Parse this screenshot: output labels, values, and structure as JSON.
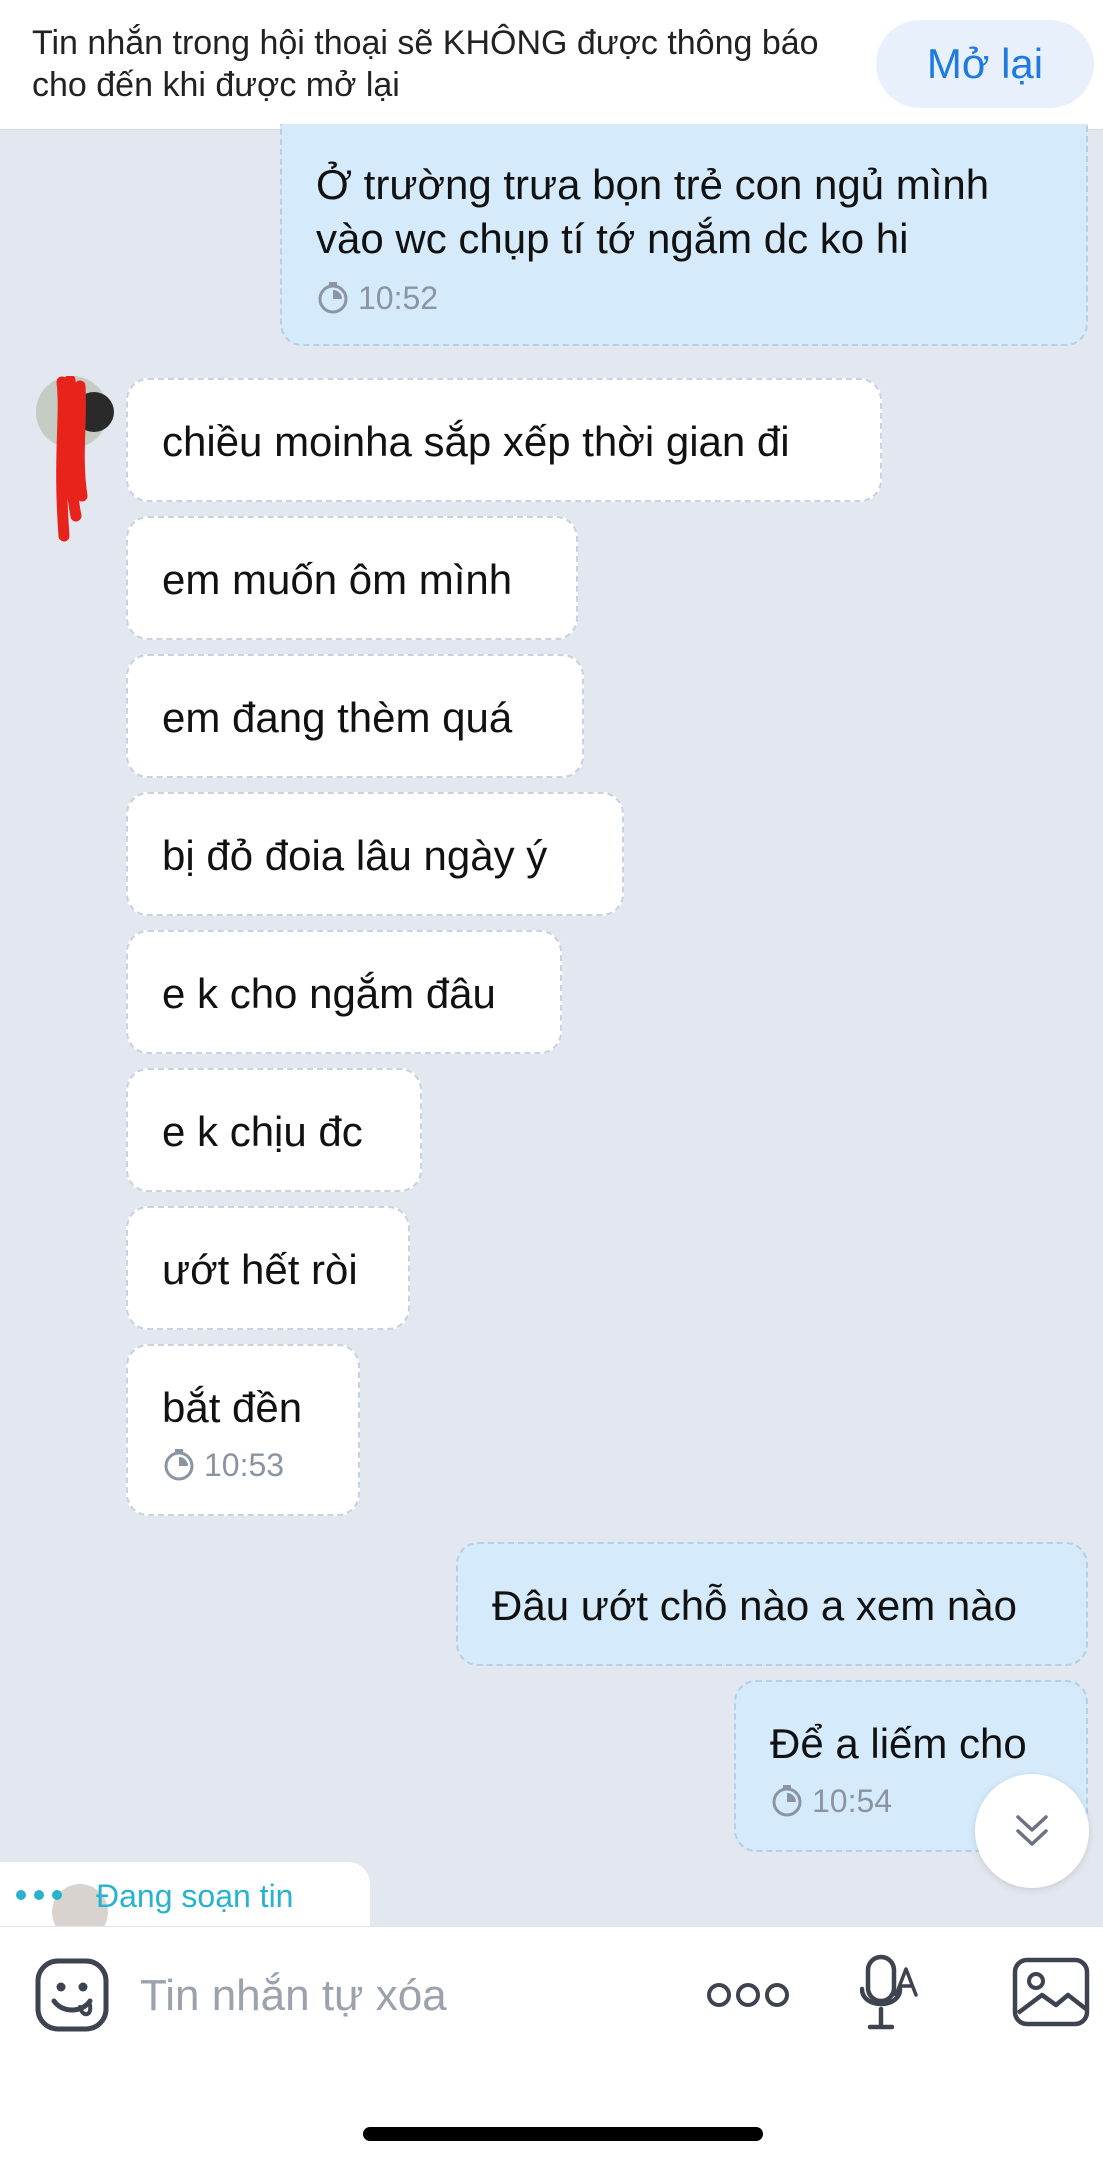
{
  "notice": {
    "text": "Tin nhắn trong hội thoại sẽ KHÔNG được thông báo cho đến khi được mở lại",
    "reopen_label": "Mở lại"
  },
  "messages": [
    {
      "direction": "out",
      "text_lines": [
        "Ở trường trưa bọn trẻ con ngủ mình",
        "vào wc chụp tí tớ ngắm dc ko hi"
      ],
      "time": "10:52"
    },
    {
      "direction": "in",
      "text": "chiều moinha sắp xếp thời gian đi"
    },
    {
      "direction": "in",
      "text": "em muốn ôm mình"
    },
    {
      "direction": "in",
      "text": "em đang thèm quá"
    },
    {
      "direction": "in",
      "text": "bị đỏ đoia lâu ngày ý"
    },
    {
      "direction": "in",
      "text": "e k cho ngắm đâu"
    },
    {
      "direction": "in",
      "text": "e k chịu đc"
    },
    {
      "direction": "in",
      "text": "ướt hết ròi"
    },
    {
      "direction": "in",
      "text": "bắt đền",
      "time": "10:53"
    },
    {
      "direction": "out",
      "text": "Đâu ướt chỗ nào a xem nào"
    },
    {
      "direction": "out",
      "text": "Để a liếm cho",
      "time": "10:54"
    }
  ],
  "typing": {
    "label": "Đang soạn tin"
  },
  "composer": {
    "placeholder": "Tin nhắn tự xóa"
  },
  "colors": {
    "background": "#e3e8f0",
    "outgoing_bubble": "#d5ebfb",
    "incoming_bubble": "#ffffff",
    "accent": "#1d7ae0",
    "typing": "#27b3cf"
  },
  "icons": [
    "clock-icon",
    "chevron-double-down-icon",
    "emoji-icon",
    "more-dots-icon",
    "voice-text-icon",
    "image-icon"
  ]
}
